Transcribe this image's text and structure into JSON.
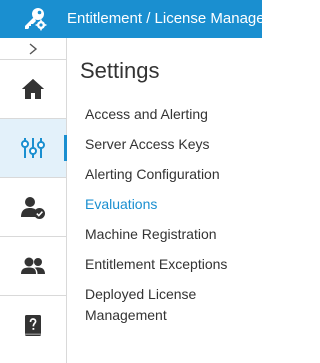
{
  "header": {
    "app_title": "Entitlement / License Management",
    "logo_icon": "key-gear-icon",
    "background_color": "#1a8fd0"
  },
  "rail": {
    "collapse_icon": "chevron-right-icon",
    "items": [
      {
        "name": "home",
        "icon": "home-icon",
        "active": false
      },
      {
        "name": "settings",
        "icon": "sliders-icon",
        "active": true
      },
      {
        "name": "user-approved",
        "icon": "user-check-icon",
        "active": false
      },
      {
        "name": "users",
        "icon": "users-icon",
        "active": false
      },
      {
        "name": "help",
        "icon": "help-book-icon",
        "active": false
      }
    ],
    "active_background": "#e3f1fa",
    "active_accent": "#1a8fd0"
  },
  "settings": {
    "title": "Settings",
    "items": [
      {
        "label": "Access and Alerting"
      },
      {
        "label": "Server Access Keys"
      },
      {
        "label": "Alerting Configuration"
      },
      {
        "label": "Evaluations",
        "selected": true
      },
      {
        "label": "Machine Registration"
      },
      {
        "label": "Entitlement Exceptions"
      },
      {
        "label": "Deployed License Management"
      }
    ],
    "selected_color": "#1a8fd0"
  }
}
